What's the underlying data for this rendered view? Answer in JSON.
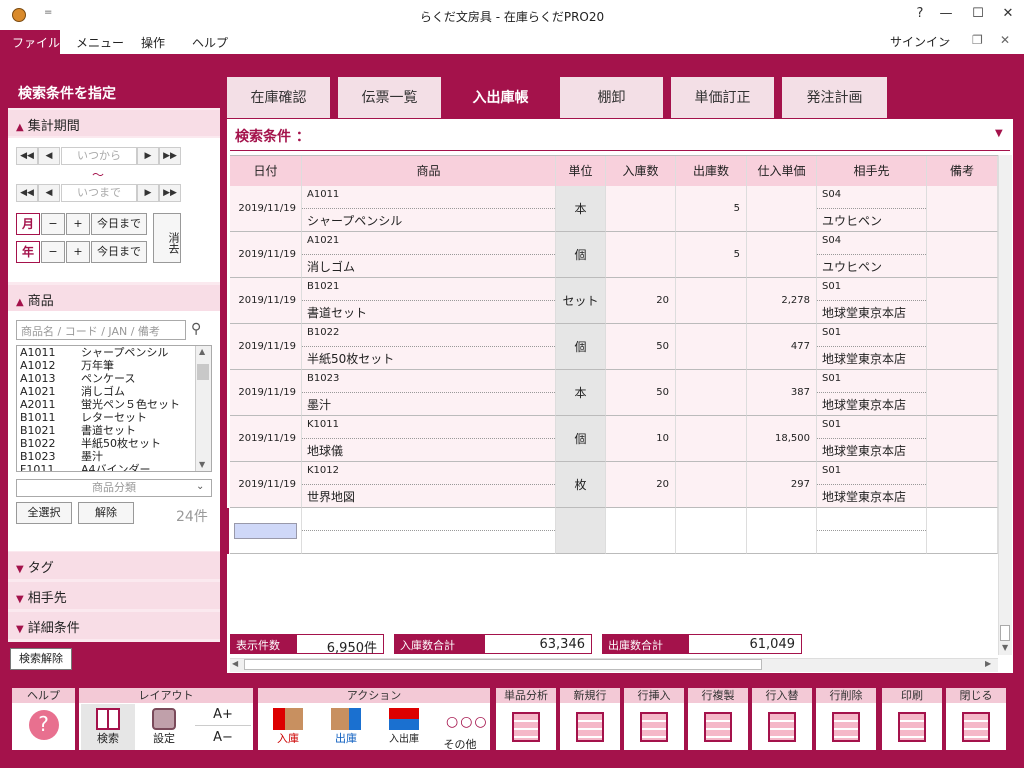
{
  "window": {
    "title": "らくだ文房具 - 在庫らくだPRO20",
    "help": "?",
    "minimize": "—",
    "maximize": "☐",
    "close": "✕",
    "quick_access": "="
  },
  "menu": {
    "file": "ファイル",
    "items": [
      "メニュー",
      "操作",
      "ヘルプ"
    ],
    "signin": "サインイン"
  },
  "left_panel": {
    "title": "検索条件を指定",
    "period": {
      "header": "集計期間",
      "from_placeholder": "いつから",
      "tilde": "～",
      "to_placeholder": "いつまで",
      "month": "月",
      "year": "年",
      "minus": "−",
      "plus": "+",
      "today": "今日まで",
      "clear": "消去"
    },
    "product": {
      "header": "商品",
      "search_placeholder": "商品名 / コード / JAN / 備考",
      "items": [
        [
          "A1011",
          "シャープペンシル"
        ],
        [
          "A1012",
          "万年筆"
        ],
        [
          "A1013",
          "ペンケース"
        ],
        [
          "A1021",
          "消しゴム"
        ],
        [
          "A2011",
          "蛍光ペン５色セット"
        ],
        [
          "B1011",
          "レターセット"
        ],
        [
          "B1021",
          "書道セット"
        ],
        [
          "B1022",
          "半紙50枚セット"
        ],
        [
          "B1023",
          "墨汁"
        ],
        [
          "F1011",
          "A4バインダー"
        ]
      ],
      "category_placeholder": "商品分類",
      "select_all": "全選択",
      "release": "解除",
      "count": "24件"
    },
    "sections": [
      "タグ",
      "相手先",
      "詳細条件"
    ],
    "clear_search": "検索解除"
  },
  "tabs": [
    "在庫確認",
    "伝票一覧",
    "入出庫帳",
    "棚卸",
    "単価訂正",
    "発注計画"
  ],
  "active_tab": "入出庫帳",
  "search_label": "検索条件 ：",
  "table": {
    "headers": [
      "日付",
      "商品",
      "単位",
      "入庫数",
      "出庫数",
      "仕入単価",
      "相手先",
      "備考"
    ],
    "rows": [
      {
        "date": "2019/11/19",
        "code": "A1011",
        "name": "シャープペンシル",
        "unit": "本",
        "in": "",
        "out": "5",
        "price": "",
        "pcode": "S04",
        "partner": "ユウヒペン"
      },
      {
        "date": "2019/11/19",
        "code": "A1021",
        "name": "消しゴム",
        "unit": "個",
        "in": "",
        "out": "5",
        "price": "",
        "pcode": "S04",
        "partner": "ユウヒペン"
      },
      {
        "date": "2019/11/19",
        "code": "B1021",
        "name": "書道セット",
        "unit": "セット",
        "in": "20",
        "out": "",
        "price": "2,278",
        "pcode": "S01",
        "partner": "地球堂東京本店"
      },
      {
        "date": "2019/11/19",
        "code": "B1022",
        "name": "半紙50枚セット",
        "unit": "個",
        "in": "50",
        "out": "",
        "price": "477",
        "pcode": "S01",
        "partner": "地球堂東京本店"
      },
      {
        "date": "2019/11/19",
        "code": "B1023",
        "name": "墨汁",
        "unit": "本",
        "in": "50",
        "out": "",
        "price": "387",
        "pcode": "S01",
        "partner": "地球堂東京本店"
      },
      {
        "date": "2019/11/19",
        "code": "K1011",
        "name": "地球儀",
        "unit": "個",
        "in": "10",
        "out": "",
        "price": "18,500",
        "pcode": "S01",
        "partner": "地球堂東京本店"
      },
      {
        "date": "2019/11/19",
        "code": "K1012",
        "name": "世界地図",
        "unit": "枚",
        "in": "20",
        "out": "",
        "price": "297",
        "pcode": "S01",
        "partner": "地球堂東京本店"
      }
    ]
  },
  "summary": {
    "count_label": "表示件数",
    "count_value": "6,950件",
    "in_label": "入庫数合計",
    "in_value": "63,346",
    "out_label": "出庫数合計",
    "out_value": "61,049"
  },
  "toolbar": {
    "help_group": "ヘルプ",
    "layout_group": "レイアウト",
    "action_group": "アクション",
    "search": "検索",
    "settings": "設定",
    "font_up": "A+",
    "font_down": "A−",
    "stock_in": "入庫",
    "stock_out": "出庫",
    "stock_inout": "入出庫",
    "other": "その他",
    "analysis": "単品分析",
    "new_row": "新規行",
    "insert_row": "行挿入",
    "copy_row": "行複製",
    "swap_row": "行入替",
    "delete_row": "行削除",
    "print": "印刷",
    "close": "閉じる"
  },
  "colors": {
    "accent": "#a4124b",
    "header_bg": "#f8d0dc",
    "panel_bg": "#fbe9ef"
  }
}
